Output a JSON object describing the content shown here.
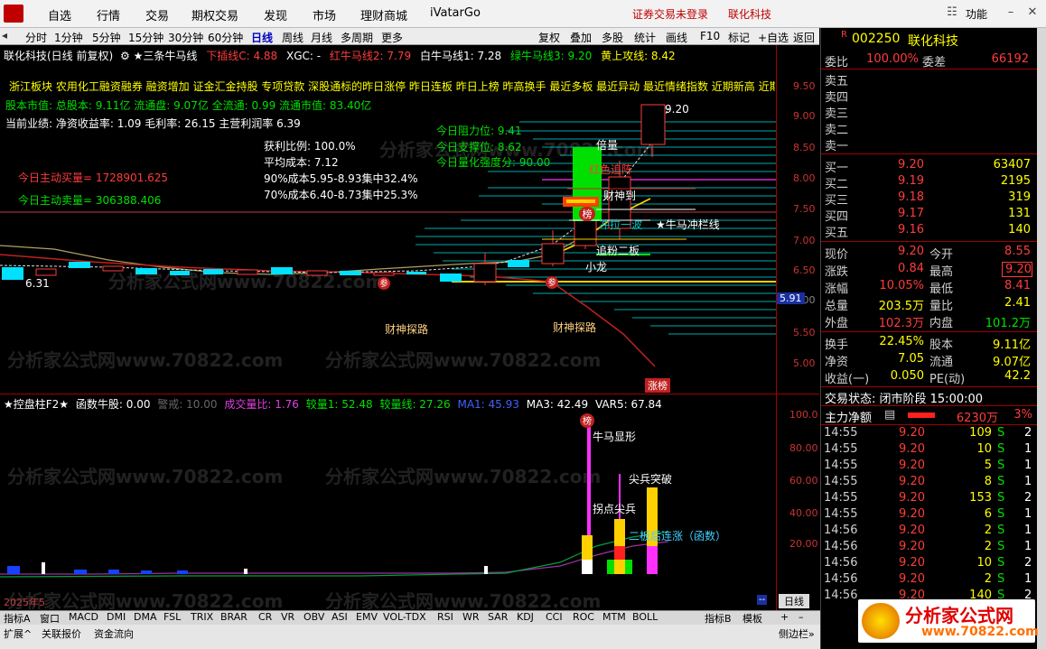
{
  "menu": [
    "自选",
    "行情",
    "交易",
    "期权交易",
    "发现",
    "市场",
    "理财商城",
    "iVatarGo"
  ],
  "warnings": {
    "not_logged": "证券交易未登录",
    "app": "联化科技"
  },
  "window": {
    "func": "功能"
  },
  "periods": [
    "分时",
    "1分钟",
    "5分钟",
    "15分钟",
    "30分钟",
    "60分钟",
    "日线",
    "周线",
    "月线",
    "多周期",
    "更多"
  ],
  "toolbar": [
    "复权",
    "叠加",
    "多股",
    "统计",
    "画线",
    "F10",
    "标记",
    "+自选",
    "返回"
  ],
  "chart_title": {
    "stock": "联化科技(日线 前复权)",
    "indicator": "★三条牛马线",
    "xiacha": "下插线C: 4.88",
    "xgc": "XGC: -",
    "hong": "红牛马线2: 7.79",
    "bai": "白牛马线1: 7.28",
    "lv": "绿牛马线3: 9.20",
    "huang": "黄上攻线: 8.42"
  },
  "info_lines": {
    "concepts": "浙江板块 农用化工融资融券 融资增加 证金汇金持股 专项贷款 深股通标的昨日涨停 昨日连板 昨日上榜 昨高换手 最近多板 最近异动 最近情绪指数 近期新高 近期",
    "caps": "股本市值: 总股本: 9.11亿 流通盘: 9.07亿 全流通: 0.99 流通市值: 83.40亿",
    "perf": "当前业绩: 净资收益率: 1.09 毛利率: 26.15 主营利润率 6.39",
    "buy": "今日主动买量= 1728901.625",
    "sell": "今日主动卖量= 306388.406"
  },
  "cost": [
    "获利比例: 100.0%",
    "平均成本: 7.12",
    "90%成本5.95-8.93集中32.4%",
    "70%成本6.40-8.73集中25.3%"
  ],
  "levels": {
    "resist": "今日阻力位: 9.41",
    "support": "今日支撑位: 8.62",
    "strength": "今日量化强度分: 90.00"
  },
  "annotations": {
    "beiliang": "倍量",
    "hongse": "红色追阵",
    "caishen": "财神到",
    "bang": "榜",
    "chongla": "冲拉一波",
    "niuma": "★牛马冲栏线",
    "zhuifen": "追粉二板",
    "xiaolong": "小龙",
    "zhangbang": "涨榜",
    "tanlu1": "财神探路",
    "tanlu2": "财神探路",
    "low": "6.31",
    "high": "9.20",
    "zhangbang_label": "涨榜"
  },
  "price_axis": [
    "9.50",
    "9.00",
    "8.50",
    "8.00",
    "7.50",
    "7.00",
    "6.50",
    "6.00",
    "5.50",
    "5.00"
  ],
  "cursor_price": "5.91",
  "sub_title": {
    "name": "★控盘柱F2★",
    "fn": "函数牛股: 0.00",
    "alarm": "警戒: 10.00",
    "vr": "成交量比: 1.76",
    "lv": "较量1: 52.48",
    "lvl": "较量线: 27.26",
    "ma1": "MA1: 45.93",
    "ma3": "MA3: 42.49",
    "var5": "VAR5: 67.84"
  },
  "sub_axis": [
    "100.0",
    "80.00",
    "60.00",
    "40.00",
    "20.00"
  ],
  "sub_ann": {
    "bang": "榜",
    "niumaxian": "牛马显形",
    "jiandian": "拐点尖兵",
    "jianbing": "尖兵突破",
    "erban": "二板后连涨（函数）"
  },
  "date_label": "2025年5",
  "day_btn": "日线",
  "bottom_tabs": [
    "指标A",
    "窗口",
    "MACD",
    "DMI",
    "DMA",
    "FSL",
    "TRIX",
    "BRAR",
    "CR",
    "VR",
    "OBV",
    "ASI",
    "EMV",
    "VOL-TDX",
    "RSI",
    "WR",
    "SAR",
    "KDJ",
    "CCI",
    "ROC",
    "MTM",
    "BOLL"
  ],
  "bottom_right": [
    "指标B",
    "模板"
  ],
  "status": [
    "扩展^",
    "关联报价",
    "资金流向"
  ],
  "status_right": [
    "侧边栏»",
    "笔"
  ],
  "quote": {
    "code": "002250",
    "name": "联化科技",
    "weibi_l": "委比",
    "weibi": "100.00%",
    "weicha_l": "委差",
    "weicha": "66192",
    "sell": [
      {
        "l": "卖五"
      },
      {
        "l": "卖四"
      },
      {
        "l": "卖三"
      },
      {
        "l": "卖二"
      },
      {
        "l": "卖一"
      }
    ],
    "buy": [
      {
        "l": "买一",
        "p": "9.20",
        "v": "63407"
      },
      {
        "l": "买二",
        "p": "9.19",
        "v": "2195"
      },
      {
        "l": "买三",
        "p": "9.18",
        "v": "319"
      },
      {
        "l": "买四",
        "p": "9.17",
        "v": "131"
      },
      {
        "l": "买五",
        "p": "9.16",
        "v": "140"
      }
    ],
    "stats": [
      {
        "l1": "现价",
        "v1": "9.20",
        "l2": "今开",
        "v2": "8.55"
      },
      {
        "l1": "涨跌",
        "v1": "0.84",
        "l2": "最高",
        "v2": "9.20"
      },
      {
        "l1": "涨幅",
        "v1": "10.05%",
        "l2": "最低",
        "v2": "8.41"
      },
      {
        "l1": "总量",
        "v1": "203.5万",
        "l2": "量比",
        "v2": "2.41"
      },
      {
        "l1": "外盘",
        "v1": "102.3万",
        "l2": "内盘",
        "v2": "101.2万"
      }
    ],
    "stats2": [
      {
        "l1": "换手",
        "v1": "22.45%",
        "l2": "股本",
        "v2": "9.11亿"
      },
      {
        "l1": "净资",
        "v1": "7.05",
        "l2": "流通",
        "v2": "9.07亿"
      },
      {
        "l1": "收益(一)",
        "v1": "0.050",
        "l2": "PE(动)",
        "v2": "42.2"
      }
    ],
    "trade_state": "交易状态: 闭市阶段 15:00:00",
    "main_net_l": "主力净额",
    "main_net": "6230万",
    "main_pct": "3%",
    "ticks": [
      {
        "t": "14:55",
        "p": "9.20",
        "v": "109",
        "s": "S",
        "n": "2"
      },
      {
        "t": "14:55",
        "p": "9.20",
        "v": "10",
        "s": "S",
        "n": "1"
      },
      {
        "t": "14:55",
        "p": "9.20",
        "v": "5",
        "s": "S",
        "n": "1"
      },
      {
        "t": "14:55",
        "p": "9.20",
        "v": "8",
        "s": "S",
        "n": "1"
      },
      {
        "t": "14:55",
        "p": "9.20",
        "v": "153",
        "s": "S",
        "n": "2"
      },
      {
        "t": "14:55",
        "p": "9.20",
        "v": "6",
        "s": "S",
        "n": "1"
      },
      {
        "t": "14:56",
        "p": "9.20",
        "v": "2",
        "s": "S",
        "n": "1"
      },
      {
        "t": "14:56",
        "p": "9.20",
        "v": "2",
        "s": "S",
        "n": "1"
      },
      {
        "t": "14:56",
        "p": "9.20",
        "v": "10",
        "s": "S",
        "n": "2"
      },
      {
        "t": "14:56",
        "p": "9.20",
        "v": "2",
        "s": "S",
        "n": "1"
      },
      {
        "t": "14:56",
        "p": "9.20",
        "v": "140",
        "s": "S",
        "n": "2"
      }
    ]
  },
  "watermark": "分析家公式网www.70822.com",
  "brand": {
    "cn": "分析家公式网",
    "url": "www.70822.com"
  },
  "colors": {
    "up": "#ff3c3c",
    "down": "#00e0ff",
    "accent": "#c00000"
  }
}
